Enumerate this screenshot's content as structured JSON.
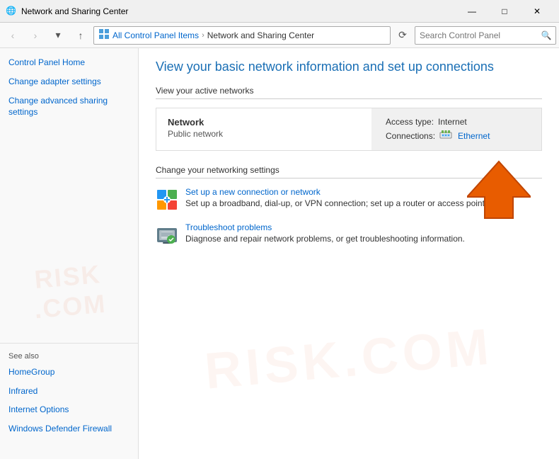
{
  "window": {
    "title": "Network and Sharing Center",
    "icon": "🌐"
  },
  "title_bar": {
    "minimize_label": "—",
    "maximize_label": "□",
    "close_label": "✕"
  },
  "address_bar": {
    "back_btn": "‹",
    "forward_btn": "›",
    "up_btn": "↑",
    "path": {
      "part1": "All Control Panel Items",
      "separator1": "›",
      "part2": "Network and Sharing Center"
    },
    "refresh_btn": "⟳",
    "search_placeholder": "Search Control Panel",
    "search_icon": "🔍"
  },
  "sidebar": {
    "nav_items": [
      {
        "label": "Control Panel Home",
        "href": true
      },
      {
        "label": "Change adapter settings",
        "href": true
      },
      {
        "label": "Change advanced sharing settings",
        "href": true
      }
    ],
    "see_also_title": "See also",
    "see_also_items": [
      {
        "label": "HomeGroup"
      },
      {
        "label": "Infrared"
      },
      {
        "label": "Internet Options"
      },
      {
        "label": "Windows Defender Firewall"
      }
    ]
  },
  "content": {
    "page_title": "View your basic network information and set up connections",
    "active_networks_header": "View your active networks",
    "network": {
      "name": "Network",
      "type": "Public network",
      "access_label": "Access type:",
      "access_value": "Internet",
      "connections_label": "Connections:",
      "connections_value": "Ethernet"
    },
    "change_settings_header": "Change your networking settings",
    "settings_items": [
      {
        "link": "Set up a new connection or network",
        "desc": "Set up a broadband, dial-up, or VPN connection; set up a router or access point."
      },
      {
        "link": "Troubleshoot problems",
        "desc": "Diagnose and repair network problems, or get troubleshooting information."
      }
    ]
  }
}
